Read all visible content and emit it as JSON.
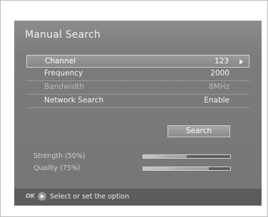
{
  "header": {
    "title": "Manual Search"
  },
  "settings": [
    {
      "label": "Channel",
      "value": "123"
    },
    {
      "label": "Frequency",
      "value": "2000"
    },
    {
      "label": "Bandwidth",
      "value": "8MHz"
    },
    {
      "label": "Network Search",
      "value": "Enable"
    }
  ],
  "search_button": {
    "label": "Search"
  },
  "signal": {
    "strength": {
      "label": "Strength (50%)",
      "level": 0.5
    },
    "quality": {
      "label": "Quality (75%)",
      "level": 0.75
    }
  },
  "footer": {
    "ok_key": "OK",
    "hint": "Select or set the option"
  },
  "icons": {
    "option_arrow": "chevron-right-icon",
    "play": "play-icon"
  }
}
